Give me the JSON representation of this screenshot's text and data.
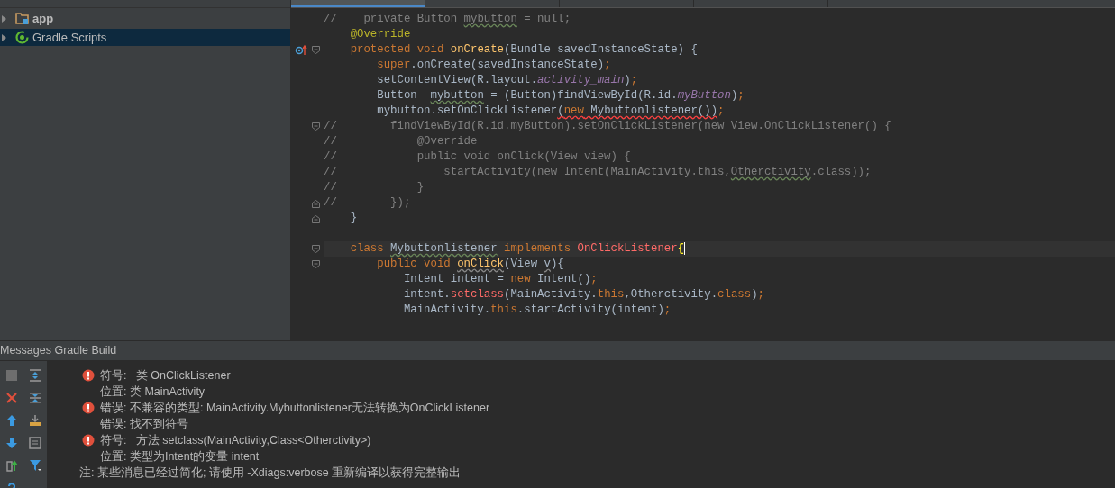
{
  "project_tree": {
    "items": [
      {
        "label": "app",
        "kind": "module",
        "selected": false
      },
      {
        "label": "Gradle Scripts",
        "kind": "gradle",
        "selected": true
      }
    ]
  },
  "editor": {
    "tabs": [
      {
        "selected": true
      },
      {
        "selected": false
      },
      {
        "selected": false
      },
      {
        "selected": false
      }
    ],
    "lines": [
      {
        "current": false,
        "kind": "plain",
        "tokens": [
          {
            "kind": "comment",
            "text": "//    private Button ",
            "warning": false,
            "error": false
          },
          {
            "kind": "comment",
            "text": "mybutton",
            "warning": true,
            "error": false
          },
          {
            "kind": "comment",
            "text": " = null;",
            "warning": false,
            "error": false
          }
        ]
      },
      {
        "current": false,
        "kind": "plain",
        "tokens": [
          {
            "kind": "annotation",
            "text": "    @Override",
            "warning": false,
            "error": false
          }
        ]
      },
      {
        "current": false,
        "kind": "override",
        "tokens": [
          {
            "kind": "keyword",
            "text": "    protected void ",
            "warning": false,
            "error": false
          },
          {
            "kind": "method",
            "text": "onCreate",
            "warning": false,
            "error": false
          },
          {
            "kind": "plain",
            "text": "(Bundle savedInstanceState) {",
            "warning": false,
            "error": false
          }
        ]
      },
      {
        "current": false,
        "kind": "plain",
        "tokens": [
          {
            "kind": "keyword",
            "text": "        super",
            "warning": false,
            "error": false
          },
          {
            "kind": "plain",
            "text": ".onCreate(savedInstanceState)",
            "warning": false,
            "error": false
          },
          {
            "kind": "keyword",
            "text": ";",
            "warning": false,
            "error": false
          }
        ]
      },
      {
        "current": false,
        "kind": "plain",
        "tokens": [
          {
            "kind": "plain",
            "text": "        setContentView(R.layout.",
            "warning": false,
            "error": false
          },
          {
            "kind": "field",
            "text": "activity_main",
            "warning": false,
            "error": false
          },
          {
            "kind": "plain",
            "text": ")",
            "warning": false,
            "error": false
          },
          {
            "kind": "keyword",
            "text": ";",
            "warning": false,
            "error": false
          }
        ]
      },
      {
        "current": false,
        "kind": "plain",
        "tokens": [
          {
            "kind": "plain",
            "text": "        Button  ",
            "warning": false,
            "error": false
          },
          {
            "kind": "plain",
            "text": "mybutton",
            "warning": true,
            "error": false
          },
          {
            "kind": "plain",
            "text": " = (Button)findViewById(R.id.",
            "warning": false,
            "error": false
          },
          {
            "kind": "field",
            "text": "myButton",
            "warning": false,
            "error": false
          },
          {
            "kind": "plain",
            "text": ")",
            "warning": false,
            "error": false
          },
          {
            "kind": "keyword",
            "text": ";",
            "warning": false,
            "error": false
          }
        ]
      },
      {
        "current": false,
        "kind": "plain",
        "tokens": [
          {
            "kind": "plain",
            "text": "        mybutton.setOnClickListener",
            "warning": false,
            "error": false
          },
          {
            "kind": "plain",
            "text": "(",
            "warning": false,
            "error": true
          },
          {
            "kind": "keyword",
            "text": "new",
            "warning": false,
            "error": true
          },
          {
            "kind": "plain",
            "text": " Mybuttonlistener())",
            "warning": false,
            "error": true
          },
          {
            "kind": "keyword",
            "text": ";",
            "warning": false,
            "error": false
          }
        ]
      },
      {
        "current": false,
        "kind": "fold_start",
        "tokens": [
          {
            "kind": "comment",
            "text": "//        findViewById(R.id.myButton).setOnClickListener(new View.OnClickListener() {",
            "warning": false,
            "error": false
          }
        ]
      },
      {
        "current": false,
        "kind": "plain",
        "tokens": [
          {
            "kind": "comment",
            "text": "//            @Override",
            "warning": false,
            "error": false
          }
        ]
      },
      {
        "current": false,
        "kind": "plain",
        "tokens": [
          {
            "kind": "comment",
            "text": "//            public void onClick(View view) {",
            "warning": false,
            "error": false
          }
        ]
      },
      {
        "current": false,
        "kind": "plain",
        "tokens": [
          {
            "kind": "comment",
            "text": "//                startActivity(new Intent(MainActivity.this,",
            "warning": false,
            "error": false
          },
          {
            "kind": "comment",
            "text": "Otherctivity",
            "warning": true,
            "error": false
          },
          {
            "kind": "comment",
            "text": ".class));",
            "warning": false,
            "error": false
          }
        ]
      },
      {
        "current": false,
        "kind": "plain",
        "tokens": [
          {
            "kind": "comment",
            "text": "//            }",
            "warning": false,
            "error": false
          }
        ]
      },
      {
        "current": false,
        "kind": "fold_end",
        "tokens": [
          {
            "kind": "comment",
            "text": "//        });",
            "warning": false,
            "error": false
          }
        ]
      },
      {
        "current": false,
        "kind": "fold_end",
        "tokens": [
          {
            "kind": "plain",
            "text": "    }",
            "warning": false,
            "error": false
          }
        ]
      },
      {
        "current": false,
        "kind": "plain"
      },
      {
        "current": true,
        "kind": "fold_start",
        "tokens": [
          {
            "kind": "keyword",
            "text": "    class ",
            "warning": false,
            "error": false
          },
          {
            "kind": "plain",
            "text": "Mybuttonlistener",
            "warning": true,
            "error": false
          },
          {
            "kind": "keyword",
            "text": " implements ",
            "warning": false,
            "error": false
          },
          {
            "kind": "error",
            "text": "OnClickListener",
            "warning": false,
            "error": false
          },
          {
            "kind": "brace",
            "text": "{",
            "warning": false,
            "error": false
          }
        ]
      },
      {
        "current": false,
        "kind": "fold_start",
        "tokens": [
          {
            "kind": "keyword",
            "text": "        public void ",
            "warning": false,
            "error": false
          },
          {
            "kind": "method",
            "text": "onClick",
            "warning": true,
            "error": false
          },
          {
            "kind": "plain",
            "text": "(View ",
            "warning": false,
            "error": false
          },
          {
            "kind": "plain",
            "text": "v",
            "warning": true,
            "error": false
          },
          {
            "kind": "plain",
            "text": "){",
            "warning": false,
            "error": false
          }
        ]
      },
      {
        "current": false,
        "kind": "plain",
        "tokens": [
          {
            "kind": "plain",
            "text": "            Intent intent = ",
            "warning": false,
            "error": false
          },
          {
            "kind": "keyword",
            "text": "new",
            "warning": false,
            "error": false
          },
          {
            "kind": "plain",
            "text": " Intent()",
            "warning": false,
            "error": false
          },
          {
            "kind": "keyword",
            "text": ";",
            "warning": false,
            "error": false
          }
        ]
      },
      {
        "current": false,
        "kind": "plain",
        "tokens": [
          {
            "kind": "plain",
            "text": "            intent.",
            "warning": false,
            "error": false
          },
          {
            "kind": "error",
            "text": "setclass",
            "warning": false,
            "error": false
          },
          {
            "kind": "plain",
            "text": "(MainActivity.",
            "warning": false,
            "error": false
          },
          {
            "kind": "keyword",
            "text": "this",
            "warning": false,
            "error": false
          },
          {
            "kind": "plain",
            "text": ",Otherctivity.",
            "warning": false,
            "error": false
          },
          {
            "kind": "keyword",
            "text": "class",
            "warning": false,
            "error": false
          },
          {
            "kind": "plain",
            "text": ")",
            "warning": false,
            "error": false
          },
          {
            "kind": "keyword",
            "text": ";",
            "warning": false,
            "error": false
          }
        ]
      },
      {
        "current": false,
        "kind": "plain",
        "tokens": [
          {
            "kind": "plain",
            "text": "            MainActivity.",
            "warning": false,
            "error": false
          },
          {
            "kind": "keyword",
            "text": "this",
            "warning": false,
            "error": false
          },
          {
            "kind": "plain",
            "text": ".startActivity(intent)",
            "warning": false,
            "error": false
          },
          {
            "kind": "keyword",
            "text": ";",
            "warning": false,
            "error": false
          }
        ]
      }
    ]
  },
  "messages_panel": {
    "title": "Messages Gradle Build",
    "messages": [
      {
        "kind": "error",
        "text": "符号:   类 OnClickListener"
      },
      {
        "kind": "detail",
        "text": "位置: 类 MainActivity"
      },
      {
        "kind": "error",
        "text": "错误: 不兼容的类型: MainActivity.Mybuttonlistener无法转换为OnClickListener"
      },
      {
        "kind": "detail",
        "text": "错误: 找不到符号"
      },
      {
        "kind": "error",
        "text": "符号:   方法 setclass(MainActivity,Class<Otherctivity>)"
      },
      {
        "kind": "detail",
        "text": "位置: 类型为Intent的变量 intent"
      },
      {
        "kind": "note",
        "text": "注: 某些消息已经过简化; 请使用 -Xdiags:verbose 重新编译以获得完整输出"
      }
    ]
  }
}
